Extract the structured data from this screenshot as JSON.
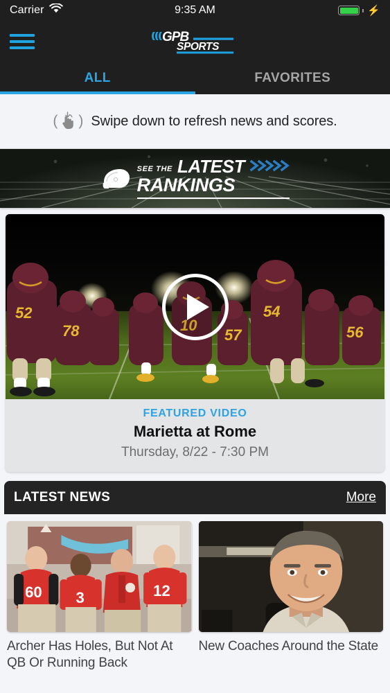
{
  "status_bar": {
    "carrier": "Carrier",
    "wifi_icon": "wifi-icon",
    "time": "9:35 AM",
    "battery_icon": "battery-full-icon",
    "charging_icon": "lightning-bolt-icon",
    "battery_color": "#35d14a"
  },
  "nav": {
    "menu_icon": "hamburger-menu-icon",
    "menu_color": "#1ea2e0",
    "logo_text_primary": "GPB",
    "logo_text_secondary": "SPORTS",
    "bar_color": "#1f1f1f"
  },
  "tabs": {
    "items": [
      {
        "label": "ALL",
        "active": true
      },
      {
        "label": "FAVORITES",
        "active": false
      }
    ],
    "active_color": "#2ba7e6",
    "inactive_color": "#a6a6a6",
    "indicator_color": "#29a5e3"
  },
  "refresh_banner": {
    "icon": "swipe-down-hand-icon",
    "text": "Swipe down to refresh news and scores.",
    "background": "#f2f4f8"
  },
  "rankings_banner": {
    "icon": "football-helmet-icon",
    "eyebrow": "SEE THE",
    "line1": "LATEST",
    "line2": "RANKINGS",
    "chevron_icon": "chevrons-right-icon",
    "chevron_color": "#2a7fc4"
  },
  "featured_video": {
    "label": "FEATURED VIDEO",
    "title": "Marietta at Rome",
    "subtitle": "Thursday, 8/22 - 7:30 PM",
    "play_icon": "play-button-icon",
    "label_color": "#2ea3e4",
    "thumbnail_alt": "High school football team in maroon and gold uniforms running onto a lit field at night"
  },
  "latest_news": {
    "section_title": "LATEST NEWS",
    "more_label": "More",
    "header_color": "#242424",
    "cards": [
      {
        "headline": "Archer Has Holes, But Not At QB Or Running Back",
        "image_alt": "Three high school football players in red jerseys numbered 60, 3 and 12 standing with their coach in a red polo shirt"
      },
      {
        "headline": "New Coaches Around the State",
        "image_alt": "Smiling man with short gray hair in a light collared shirt seated indoors"
      }
    ]
  },
  "theme": {
    "page_background": "#f4f5f9",
    "accent_blue": "#2ba7e6",
    "dark": "#1f1f1f"
  }
}
